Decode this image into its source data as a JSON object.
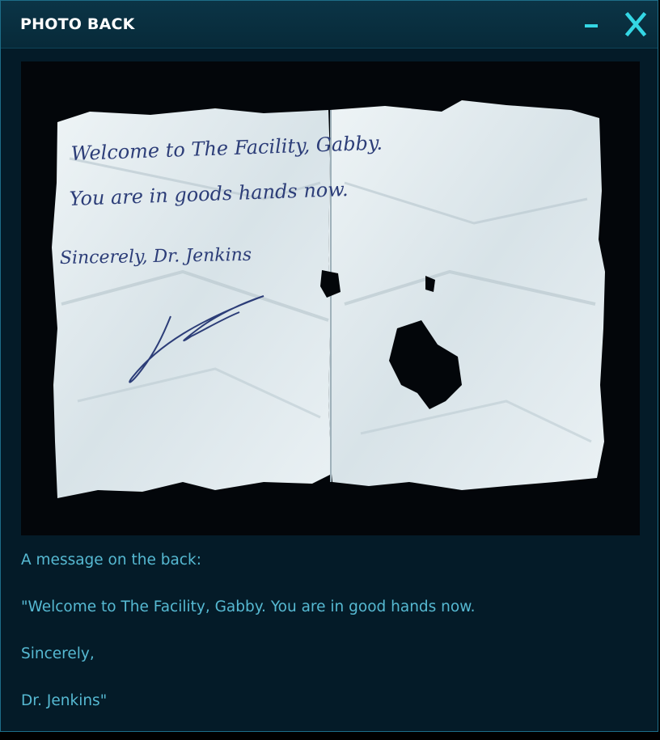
{
  "window": {
    "title": "PHOTO BACK",
    "minimize_icon": "minimize-icon",
    "close_icon": "close-icon",
    "accent_color": "#34d6e4"
  },
  "photo": {
    "handwriting": {
      "line1": "Welcome to The Facility, Gabby.",
      "line2": "You are in goods hands now.",
      "line3": "Sincerely, Dr. Jenkins"
    }
  },
  "caption": {
    "line1": "A message on the back:",
    "line2": "\"Welcome to The Facility, Gabby. You are in good hands now.",
    "line3": "Sincerely,",
    "line4": "Dr. Jenkins\""
  }
}
